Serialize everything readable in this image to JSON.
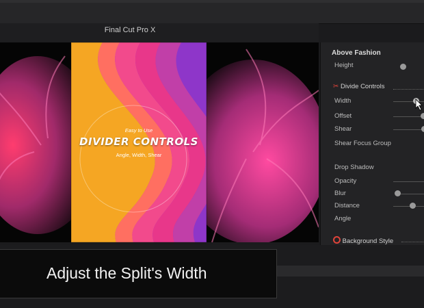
{
  "app": {
    "title": "Final Cut Pro X"
  },
  "video": {
    "tagline": "Easy to Use",
    "title": "DIVIDER CONTROLS",
    "subtitle": "Angle, Width, Shear"
  },
  "inspector": {
    "title": "Above Fashion",
    "height_label": "Height",
    "divide_controls_label": "Divide Controls",
    "width_label": "Width",
    "offset_label": "Offset",
    "shear_label": "Shear",
    "shear_focus_label": "Shear Focus Group",
    "drop_shadow_label": "Drop Shadow",
    "opacity_label": "Opacity",
    "blur_label": "Blur",
    "distance_label": "Distance",
    "angle_label": "Angle",
    "background_style_label": "Background Style"
  },
  "caption": {
    "text": "Adjust the Split's Width"
  },
  "colors": {
    "accent_red": "#e0443a",
    "panel": "#232325"
  },
  "icons": [
    "scissors-icon",
    "record-icon",
    "mouse-cursor-icon"
  ]
}
